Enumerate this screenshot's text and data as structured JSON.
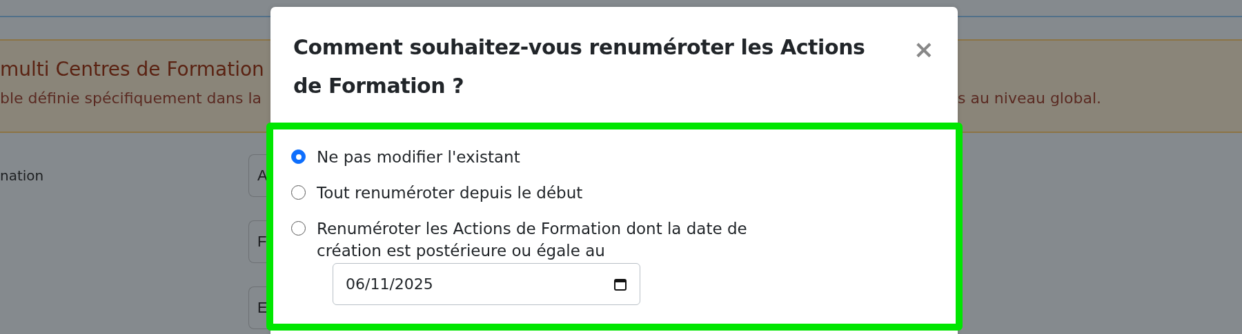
{
  "background": {
    "alert": {
      "title": "multi Centres de Formation",
      "text_left": "ble définie spécifiquement dans la",
      "text_right": "s au niveau global."
    },
    "form": {
      "label": "nation",
      "fields": [
        "A",
        "F",
        "E"
      ]
    }
  },
  "dialog": {
    "title": "Comment souhaitez-vous renuméroter les Actions de Formation ?",
    "close": "×",
    "options": [
      {
        "label": "Ne pas modifier l'existant",
        "selected": true
      },
      {
        "label": "Tout renuméroter depuis le début",
        "selected": false
      },
      {
        "label": "Renuméroter les Actions de Formation dont la date de création est postérieure ou égale au",
        "selected": false
      }
    ],
    "date": {
      "value": "06/11/2025"
    }
  }
}
